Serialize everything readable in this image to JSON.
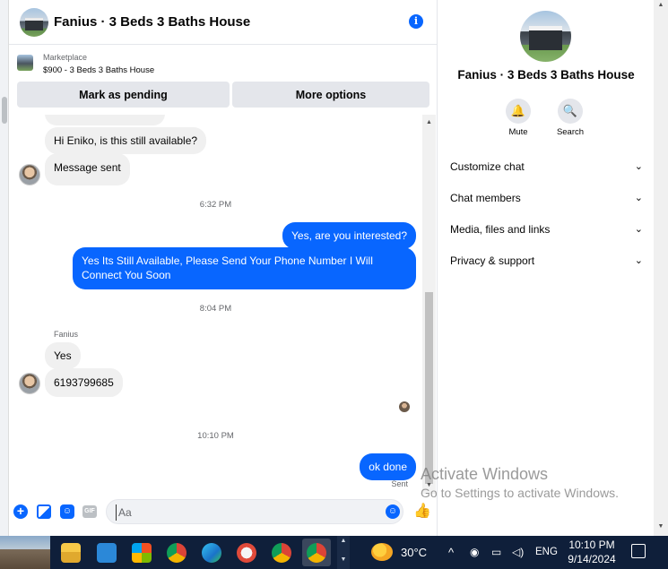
{
  "chat": {
    "title": "Fanius · 3 Beds 3 Baths House",
    "marketplace_label": "Marketplace",
    "listing": "$900 - 3 Beds 3 Baths House",
    "btn_pending": "Mark as pending",
    "btn_more": "More options",
    "messages": {
      "m1": "Hi Eniko, is this still available?",
      "m2": "Message sent",
      "t1": "6:32 PM",
      "m3": "Yes, are you interested?",
      "m4": "Yes Its Still Available, Please Send Your Phone Number I Will Connect You Soon",
      "t2": "8:04 PM",
      "sender": "Fanius",
      "m5": "Yes",
      "m6": "6193799685",
      "t3": "10:10 PM",
      "m7": "ok done",
      "sent": "Sent"
    },
    "composer_placeholder": "Aa"
  },
  "details": {
    "title": "Fanius · 3 Beds 3 Baths House",
    "mute": "Mute",
    "search": "Search",
    "rows": [
      "Customize chat",
      "Chat members",
      "Media, files and links",
      "Privacy & support"
    ]
  },
  "watermark": {
    "line1": "Activate Windows",
    "line2": "Go to Settings to activate Windows."
  },
  "taskbar": {
    "temp": "30°C",
    "lang": "ENG",
    "time": "10:10 PM",
    "date": "9/14/2024"
  },
  "colors": {
    "accent": "#0866ff",
    "incoming_bubble": "#f0f0f0",
    "taskbar": "#0f1f3a"
  }
}
